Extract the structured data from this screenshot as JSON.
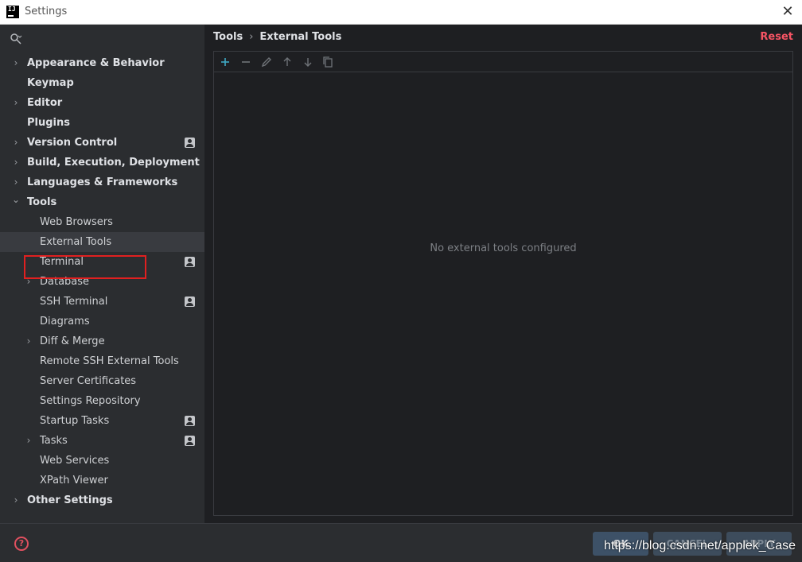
{
  "window": {
    "app_icon_text": "IJ",
    "title": "Settings",
    "close_icon": "close-icon"
  },
  "sidebar": {
    "search_icon": "search-icon",
    "items": [
      {
        "label": "Appearance & Behavior",
        "level": 0,
        "expandable": true,
        "expanded": false,
        "badge": false
      },
      {
        "label": "Keymap",
        "level": 0,
        "expandable": false,
        "badge": false
      },
      {
        "label": "Editor",
        "level": 0,
        "expandable": true,
        "expanded": false,
        "badge": false
      },
      {
        "label": "Plugins",
        "level": 0,
        "expandable": false,
        "badge": false
      },
      {
        "label": "Version Control",
        "level": 0,
        "expandable": true,
        "expanded": false,
        "badge": true
      },
      {
        "label": "Build, Execution, Deployment",
        "level": 0,
        "expandable": true,
        "expanded": false,
        "badge": false
      },
      {
        "label": "Languages & Frameworks",
        "level": 0,
        "expandable": true,
        "expanded": false,
        "badge": false
      },
      {
        "label": "Tools",
        "level": 0,
        "expandable": true,
        "expanded": true,
        "badge": false
      },
      {
        "label": "Web Browsers",
        "level": 1,
        "expandable": false,
        "badge": false
      },
      {
        "label": "External Tools",
        "level": 1,
        "expandable": false,
        "badge": false,
        "selected": true
      },
      {
        "label": "Terminal",
        "level": 1,
        "expandable": false,
        "badge": true
      },
      {
        "label": "Database",
        "level": 1,
        "expandable": true,
        "expanded": false,
        "badge": false
      },
      {
        "label": "SSH Terminal",
        "level": 1,
        "expandable": false,
        "badge": true
      },
      {
        "label": "Diagrams",
        "level": 1,
        "expandable": false,
        "badge": false
      },
      {
        "label": "Diff & Merge",
        "level": 1,
        "expandable": true,
        "expanded": false,
        "badge": false
      },
      {
        "label": "Remote SSH External Tools",
        "level": 1,
        "expandable": false,
        "badge": false
      },
      {
        "label": "Server Certificates",
        "level": 1,
        "expandable": false,
        "badge": false
      },
      {
        "label": "Settings Repository",
        "level": 1,
        "expandable": false,
        "badge": false
      },
      {
        "label": "Startup Tasks",
        "level": 1,
        "expandable": false,
        "badge": true
      },
      {
        "label": "Tasks",
        "level": 1,
        "expandable": true,
        "expanded": false,
        "badge": true
      },
      {
        "label": "Web Services",
        "level": 1,
        "expandable": false,
        "badge": false
      },
      {
        "label": "XPath Viewer",
        "level": 1,
        "expandable": false,
        "badge": false
      },
      {
        "label": "Other Settings",
        "level": 0,
        "expandable": true,
        "expanded": false,
        "badge": false
      }
    ]
  },
  "main": {
    "breadcrumb": [
      "Tools",
      "External Tools"
    ],
    "breadcrumb_separator": "›",
    "reset_label": "Reset",
    "toolbar_icons": [
      "add-icon",
      "remove-icon",
      "edit-icon",
      "move-up-icon",
      "move-down-icon",
      "copy-icon"
    ],
    "empty_text": "No external tools configured"
  },
  "footer": {
    "help_label": "?",
    "ok_label": "OK",
    "cancel_label": "CANCEL",
    "apply_label": "APPLY",
    "watermark": "https://blog.csdn.net/applek_Case"
  },
  "colors": {
    "accent_add": "#3fa9c4",
    "reset": "#f75464",
    "highlight_box": "#e02020",
    "background": "#1e1f22",
    "sidebar": "#2b2d30"
  }
}
